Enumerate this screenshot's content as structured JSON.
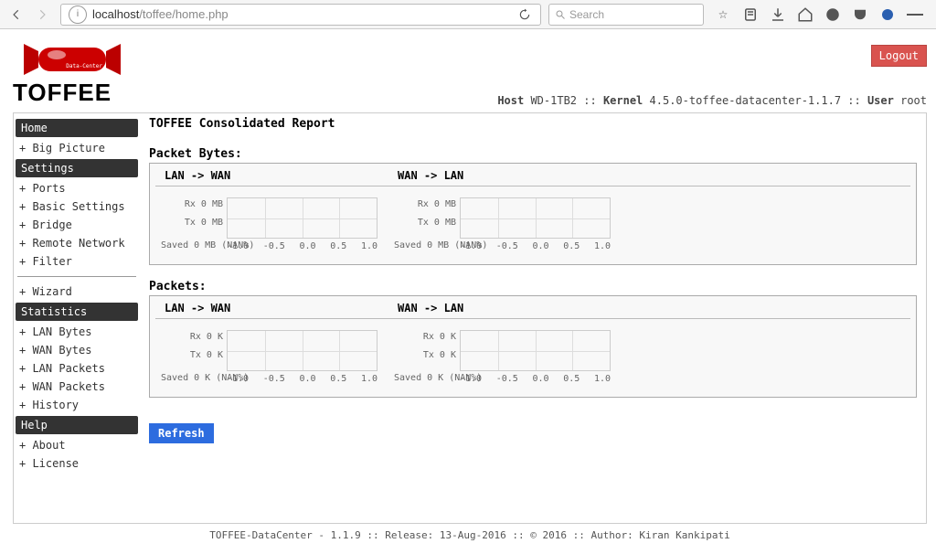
{
  "browser": {
    "url_host": "localhost",
    "url_path": "/toffee/home.php",
    "search_placeholder": "Search"
  },
  "logo": {
    "brand": "TOFFEE",
    "tag": "Data-Center"
  },
  "logout_label": "Logout",
  "hostline": {
    "host_label": "Host",
    "host_value": "WD-1TB2",
    "kernel_label": "Kernel",
    "kernel_value": "4.5.0-toffee-datacenter-1.1.7",
    "user_label": "User",
    "user_value": "root"
  },
  "sidebar": {
    "home": "Home",
    "big_picture": "Big Picture",
    "settings": "Settings",
    "ports": "Ports",
    "basic_settings": "Basic Settings",
    "bridge": "Bridge",
    "remote_network": "Remote Network",
    "filter": "Filter",
    "wizard": "Wizard",
    "statistics": "Statistics",
    "lan_bytes": "LAN Bytes",
    "wan_bytes": "WAN Bytes",
    "lan_packets": "LAN Packets",
    "wan_packets": "WAN Packets",
    "history": "History",
    "help": "Help",
    "about": "About",
    "license": "License"
  },
  "page_title": "TOFFEE Consolidated Report",
  "sections": {
    "packet_bytes": {
      "label": "Packet Bytes:",
      "lan_wan_head": "LAN  -> WAN",
      "wan_lan_head": "WAN  -> LAN",
      "rx": "Rx 0 MB",
      "tx": "Tx 0 MB",
      "saved": "Saved 0 MB (NAN%)"
    },
    "packets": {
      "label": "Packets:",
      "lan_wan_head": "LAN  -> WAN",
      "wan_lan_head": "WAN  -> LAN",
      "rx": "Rx 0 K",
      "tx": "Tx 0 K",
      "saved": "Saved 0 K (NAN%)"
    },
    "xticks": [
      "-1.0",
      "-0.5",
      "0.0",
      "0.5",
      "1.0"
    ]
  },
  "refresh_label": "Refresh",
  "footer": "TOFFEE-DataCenter - 1.1.9 :: Release: 13-Aug-2016 :: © 2016 :: Author: Kiran Kankipati",
  "chart_data": [
    {
      "type": "line",
      "title": "Packet Bytes LAN -> WAN",
      "series": [
        {
          "name": "Rx",
          "values": [],
          "unit": "MB",
          "total": 0
        },
        {
          "name": "Tx",
          "values": [],
          "unit": "MB",
          "total": 0
        }
      ],
      "saved": {
        "value": 0,
        "unit": "MB",
        "pct": "NAN%"
      },
      "xlim": [
        -1.0,
        1.0
      ]
    },
    {
      "type": "line",
      "title": "Packet Bytes WAN -> LAN",
      "series": [
        {
          "name": "Rx",
          "values": [],
          "unit": "MB",
          "total": 0
        },
        {
          "name": "Tx",
          "values": [],
          "unit": "MB",
          "total": 0
        }
      ],
      "saved": {
        "value": 0,
        "unit": "MB",
        "pct": "NAN%"
      },
      "xlim": [
        -1.0,
        1.0
      ]
    },
    {
      "type": "line",
      "title": "Packets LAN -> WAN",
      "series": [
        {
          "name": "Rx",
          "values": [],
          "unit": "K",
          "total": 0
        },
        {
          "name": "Tx",
          "values": [],
          "unit": "K",
          "total": 0
        }
      ],
      "saved": {
        "value": 0,
        "unit": "K",
        "pct": "NAN%"
      },
      "xlim": [
        -1.0,
        1.0
      ]
    },
    {
      "type": "line",
      "title": "Packets WAN -> LAN",
      "series": [
        {
          "name": "Rx",
          "values": [],
          "unit": "K",
          "total": 0
        },
        {
          "name": "Tx",
          "values": [],
          "unit": "K",
          "total": 0
        }
      ],
      "saved": {
        "value": 0,
        "unit": "K",
        "pct": "NAN%"
      },
      "xlim": [
        -1.0,
        1.0
      ]
    }
  ]
}
